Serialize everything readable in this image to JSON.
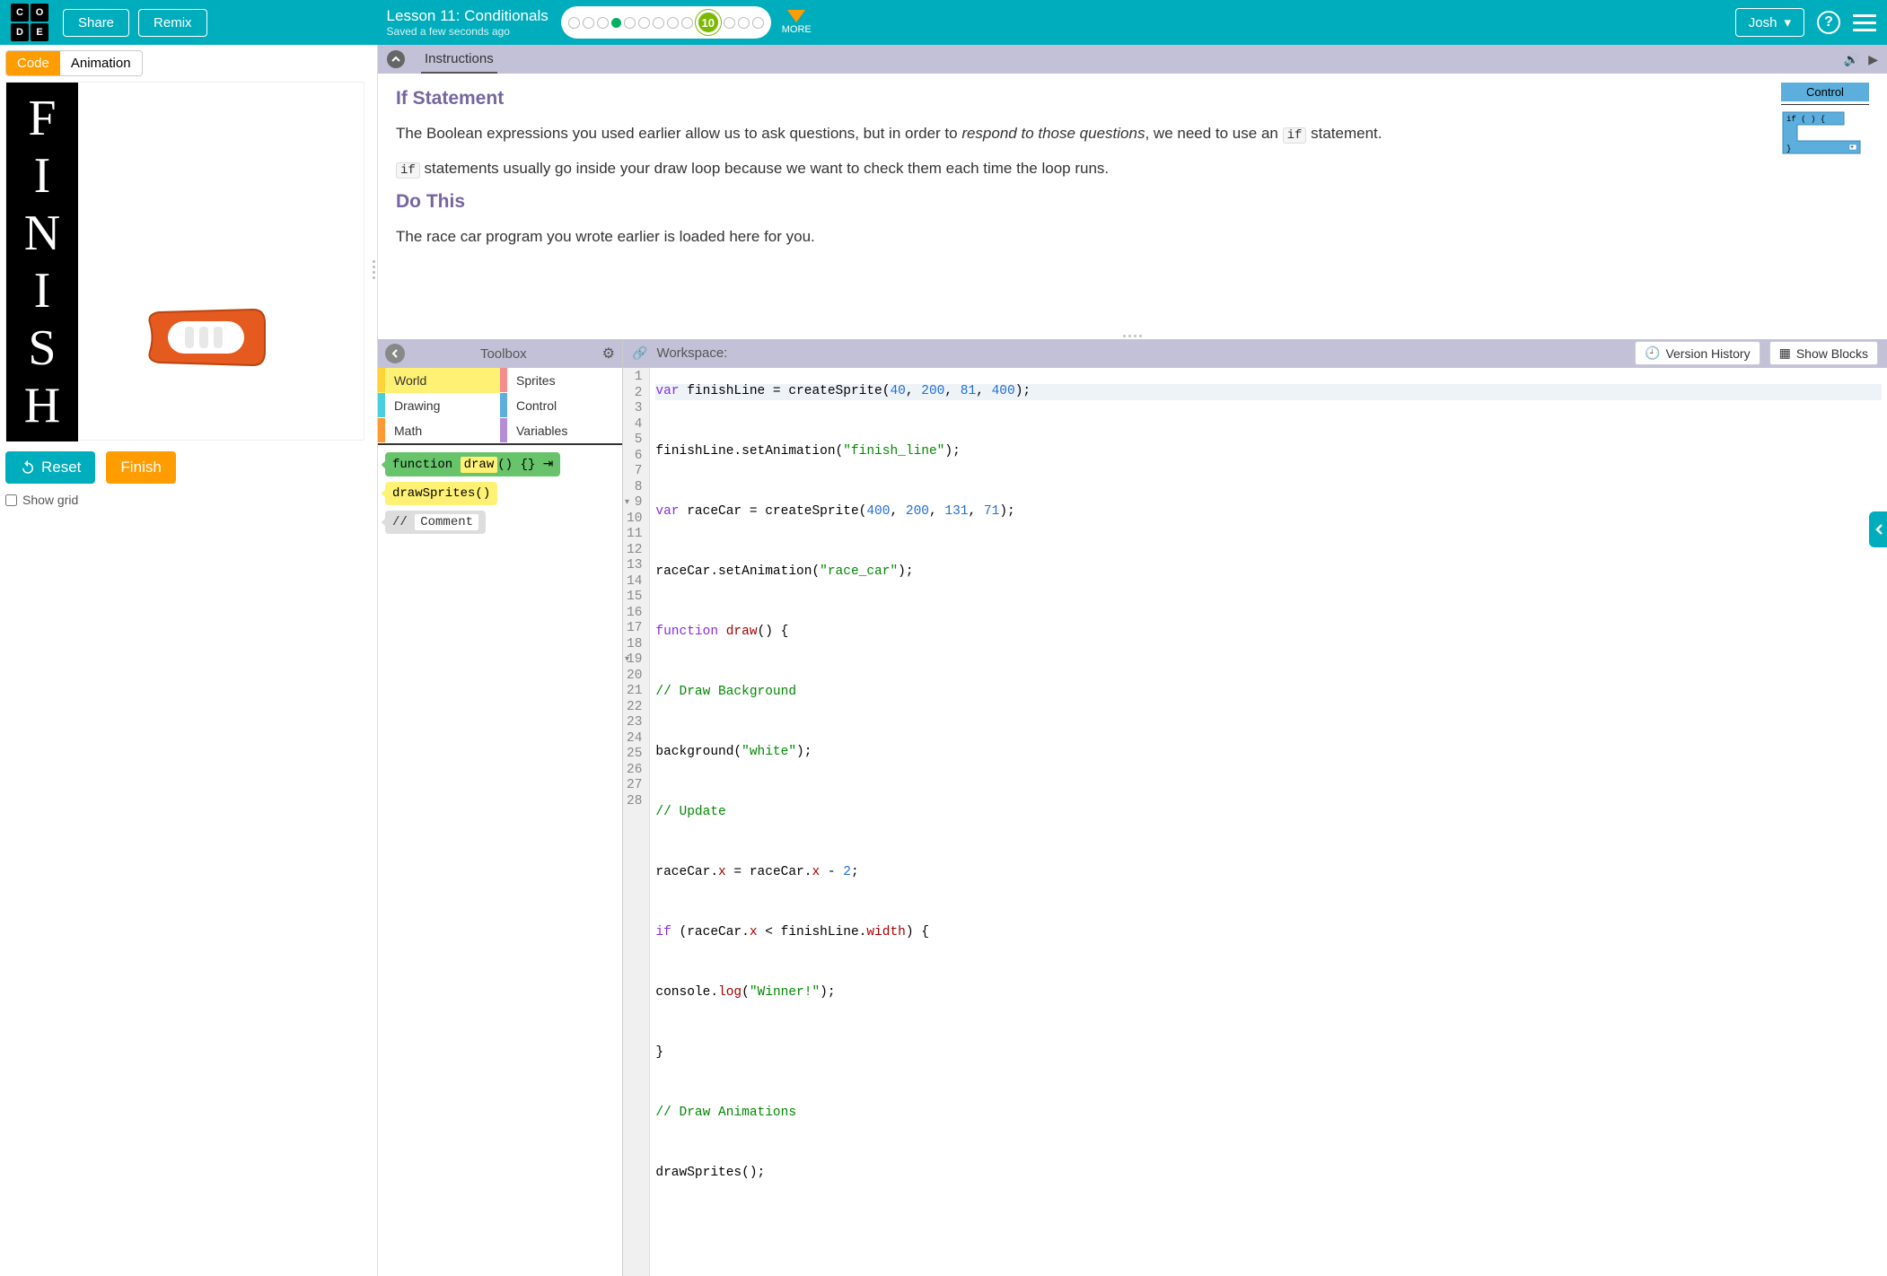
{
  "header": {
    "share": "Share",
    "remix": "Remix",
    "lesson_title": "Lesson 11: Conditionals",
    "saved": "Saved a few seconds ago",
    "current_step": "10",
    "more": "MORE",
    "user": "Josh"
  },
  "left": {
    "tab_code": "Code",
    "tab_animation": "Animation",
    "finish_letters": [
      "F",
      "I",
      "N",
      "I",
      "S",
      "H"
    ],
    "reset": "Reset",
    "finish": "Finish",
    "show_grid": "Show grid"
  },
  "instructions": {
    "tab": "Instructions",
    "h1": "If Statement",
    "p1a": "The Boolean expressions you used earlier allow us to ask questions, but in order to ",
    "p1b": "respond to those questions",
    "p1c": ", we need to use an ",
    "p1d": " statement.",
    "if": "if",
    "p2": " statements usually go inside your draw loop because we want to check them each time the loop runs.",
    "h2": "Do This",
    "p3": "The race car program you wrote earlier is loaded here for you.",
    "control": "Control"
  },
  "toolbox": {
    "title": "Toolbox",
    "world": "World",
    "sprites": "Sprites",
    "drawing": "Drawing",
    "control": "Control",
    "math": "Math",
    "variables": "Variables",
    "block_draw_a": "function ",
    "block_draw_b": "draw",
    "block_draw_c": "() {} ",
    "block_drawsprites": "drawSprites()",
    "block_comment_a": "// ",
    "block_comment_b": "Comment"
  },
  "workspace": {
    "label": "Workspace:",
    "version_history": "Version History",
    "show_blocks": "Show Blocks"
  },
  "code": {
    "l1a": "var",
    "l1b": " finishLine = createSprite(",
    "l1c": "40",
    "l1d": ", ",
    "l1e": "200",
    "l1f": ", ",
    "l1g": "81",
    "l1h": ", ",
    "l1i": "400",
    "l1j": ");",
    "l3a": "finishLine.setAnimation(",
    "l3b": "\"finish_line\"",
    "l3c": ");",
    "l5a": "var",
    "l5b": " raceCar = createSprite(",
    "l5c": "400",
    "l5d": ", ",
    "l5e": "200",
    "l5f": ", ",
    "l5g": "131",
    "l5h": ", ",
    "l5i": "71",
    "l5j": ");",
    "l7a": "raceCar.setAnimation(",
    "l7b": "\"race_car\"",
    "l7c": ");",
    "l9a": "function",
    "l9b": " ",
    "l9c": "draw",
    "l9d": "() {",
    "l11": "// Draw Background",
    "l13a": "background(",
    "l13b": "\"white\"",
    "l13c": ");",
    "l15": "// Update",
    "l17a": "raceCar.",
    "l17b": "x",
    "l17c": " = raceCar.",
    "l17d": "x",
    "l17e": " - ",
    "l17f": "2",
    "l17g": ";",
    "l19a": "if",
    "l19b": " (raceCar.",
    "l19c": "x",
    "l19d": " < finishLine.",
    "l19e": "width",
    "l19f": ") {",
    "l21a": "console.",
    "l21b": "log",
    "l21c": "(",
    "l21d": "\"Winner!\"",
    "l21e": ");",
    "l23": "}",
    "l25": "// Draw Animations",
    "l27": "drawSprites();"
  }
}
